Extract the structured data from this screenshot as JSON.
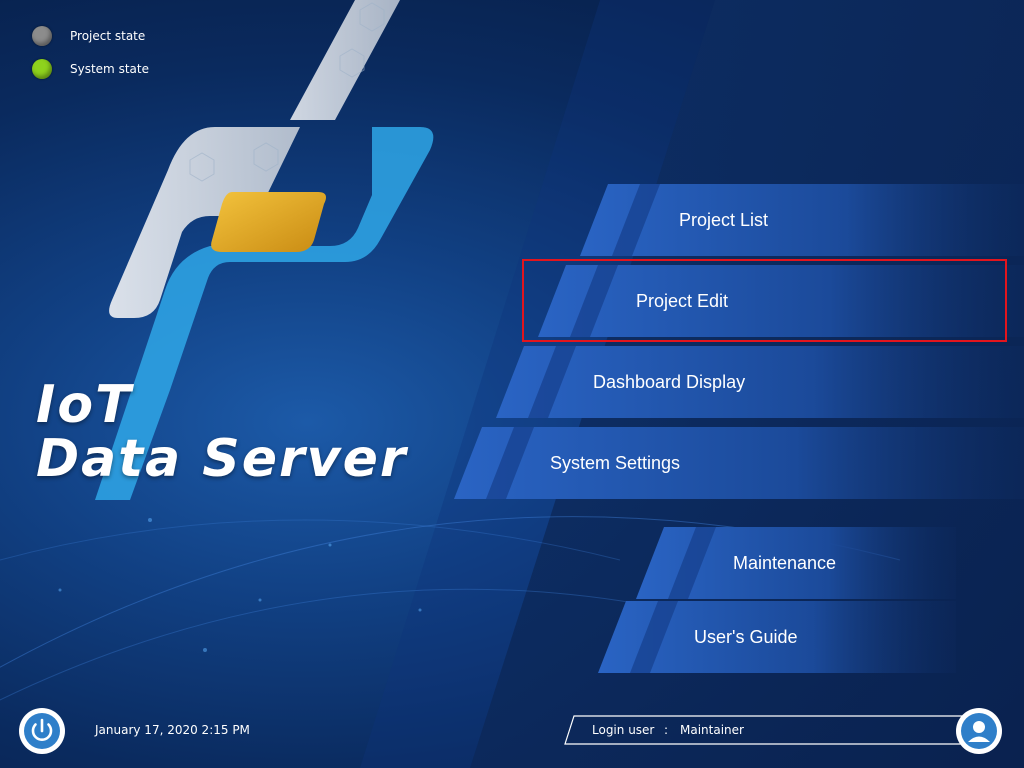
{
  "status": {
    "project_label": "Project state",
    "project_color": "#8c8c8c",
    "system_label": "System state",
    "system_color": "#8ed21d"
  },
  "app": {
    "title_line1": "IoT",
    "title_line2": "Data Server"
  },
  "menu": {
    "project_list": "Project List",
    "project_edit": "Project Edit",
    "dashboard_display": "Dashboard Display",
    "system_settings": "System Settings",
    "maintenance": "Maintenance",
    "users_guide": "User's Guide"
  },
  "footer": {
    "datetime": "January 17, 2020 2:15 PM",
    "login_label": "Login user",
    "login_separator": ":",
    "login_user": "Maintainer"
  },
  "colors": {
    "accent": "#2f6fd1",
    "highlight_border": "#e3151d"
  }
}
